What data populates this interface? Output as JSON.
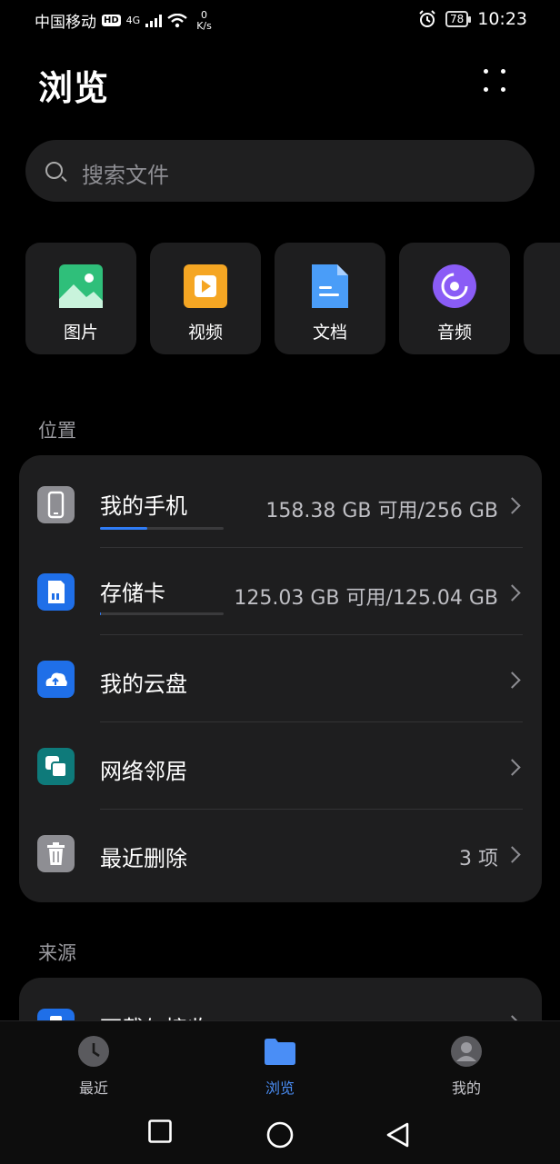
{
  "status_bar": {
    "carrier": "中国移动",
    "hd": "HD",
    "network": "4G",
    "speed_value": "0",
    "speed_unit": "K/s",
    "battery": "78",
    "time": "10:23"
  },
  "header": {
    "title": "浏览"
  },
  "search": {
    "placeholder": "搜索文件"
  },
  "categories": [
    {
      "label": "图片",
      "icon": "image-icon",
      "color": "#2fbf7a"
    },
    {
      "label": "视频",
      "icon": "video-icon",
      "color": "#f5a623"
    },
    {
      "label": "文档",
      "icon": "document-icon",
      "color": "#4a9df8"
    },
    {
      "label": "音频",
      "icon": "audio-icon",
      "color": "#8a5cf6"
    }
  ],
  "locations": {
    "section_label": "位置",
    "items": [
      {
        "name": "我的手机",
        "detail": "158.38 GB 可用/256 GB",
        "icon": "phone-icon",
        "used_fraction": 0.38
      },
      {
        "name": "存储卡",
        "detail": "125.03 GB 可用/125.04 GB",
        "icon": "sd-card-icon",
        "used_fraction": 0.0001
      },
      {
        "name": "我的云盘",
        "detail": "",
        "icon": "cloud-drive-icon"
      },
      {
        "name": "网络邻居",
        "detail": "",
        "icon": "network-neighbor-icon"
      },
      {
        "name": "最近删除",
        "detail": "3 项",
        "icon": "trash-icon"
      }
    ]
  },
  "sources": {
    "section_label": "来源",
    "items": [
      {
        "name": "下载与接收",
        "icon": "download-icon"
      }
    ]
  },
  "bottom_nav": {
    "items": [
      {
        "label": "最近",
        "icon": "clock-icon",
        "active": false
      },
      {
        "label": "浏览",
        "icon": "folder-icon",
        "active": true
      },
      {
        "label": "我的",
        "icon": "profile-icon",
        "active": false
      }
    ]
  },
  "colors": {
    "accent": "#4a8ef6",
    "background": "#000000",
    "card": "#1e1e1f"
  }
}
